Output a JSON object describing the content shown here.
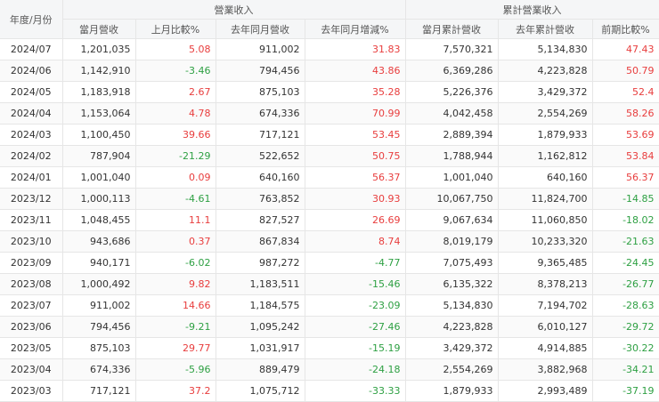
{
  "header": {
    "period_label": "年度/月份",
    "group_monthly": "營業收入",
    "group_cumulative": "累計營業收入",
    "columns": [
      "當月營收",
      "上月比較%",
      "去年同月營收",
      "去年同月增減%",
      "當月累計營收",
      "去年累計營收",
      "前期比較%"
    ]
  },
  "colors": {
    "positive": "#e83d3d",
    "negative": "#2ea043",
    "header_bg": "#f5f6f7"
  },
  "rows": [
    [
      "2024/07",
      "1,201,035",
      "5.08",
      "911,002",
      "31.83",
      "7,570,321",
      "5,134,830",
      "47.43"
    ],
    [
      "2024/06",
      "1,142,910",
      "-3.46",
      "794,456",
      "43.86",
      "6,369,286",
      "4,223,828",
      "50.79"
    ],
    [
      "2024/05",
      "1,183,918",
      "2.67",
      "875,103",
      "35.28",
      "5,226,376",
      "3,429,372",
      "52.4"
    ],
    [
      "2024/04",
      "1,153,064",
      "4.78",
      "674,336",
      "70.99",
      "4,042,458",
      "2,554,269",
      "58.26"
    ],
    [
      "2024/03",
      "1,100,450",
      "39.66",
      "717,121",
      "53.45",
      "2,889,394",
      "1,879,933",
      "53.69"
    ],
    [
      "2024/02",
      "787,904",
      "-21.29",
      "522,652",
      "50.75",
      "1,788,944",
      "1,162,812",
      "53.84"
    ],
    [
      "2024/01",
      "1,001,040",
      "0.09",
      "640,160",
      "56.37",
      "1,001,040",
      "640,160",
      "56.37"
    ],
    [
      "2023/12",
      "1,000,113",
      "-4.61",
      "763,852",
      "30.93",
      "10,067,750",
      "11,824,700",
      "-14.85"
    ],
    [
      "2023/11",
      "1,048,455",
      "11.1",
      "827,527",
      "26.69",
      "9,067,634",
      "11,060,850",
      "-18.02"
    ],
    [
      "2023/10",
      "943,686",
      "0.37",
      "867,834",
      "8.74",
      "8,019,179",
      "10,233,320",
      "-21.63"
    ],
    [
      "2023/09",
      "940,171",
      "-6.02",
      "987,272",
      "-4.77",
      "7,075,493",
      "9,365,485",
      "-24.45"
    ],
    [
      "2023/08",
      "1,000,492",
      "9.82",
      "1,183,511",
      "-15.46",
      "6,135,322",
      "8,378,213",
      "-26.77"
    ],
    [
      "2023/07",
      "911,002",
      "14.66",
      "1,184,575",
      "-23.09",
      "5,134,830",
      "7,194,702",
      "-28.63"
    ],
    [
      "2023/06",
      "794,456",
      "-9.21",
      "1,095,242",
      "-27.46",
      "4,223,828",
      "6,010,127",
      "-29.72"
    ],
    [
      "2023/05",
      "875,103",
      "29.77",
      "1,031,917",
      "-15.19",
      "3,429,372",
      "4,914,885",
      "-30.22"
    ],
    [
      "2023/04",
      "674,336",
      "-5.96",
      "889,479",
      "-24.18",
      "2,554,269",
      "3,882,968",
      "-34.21"
    ],
    [
      "2023/03",
      "717,121",
      "37.2",
      "1,075,712",
      "-33.33",
      "1,879,933",
      "2,993,489",
      "-37.19"
    ]
  ]
}
